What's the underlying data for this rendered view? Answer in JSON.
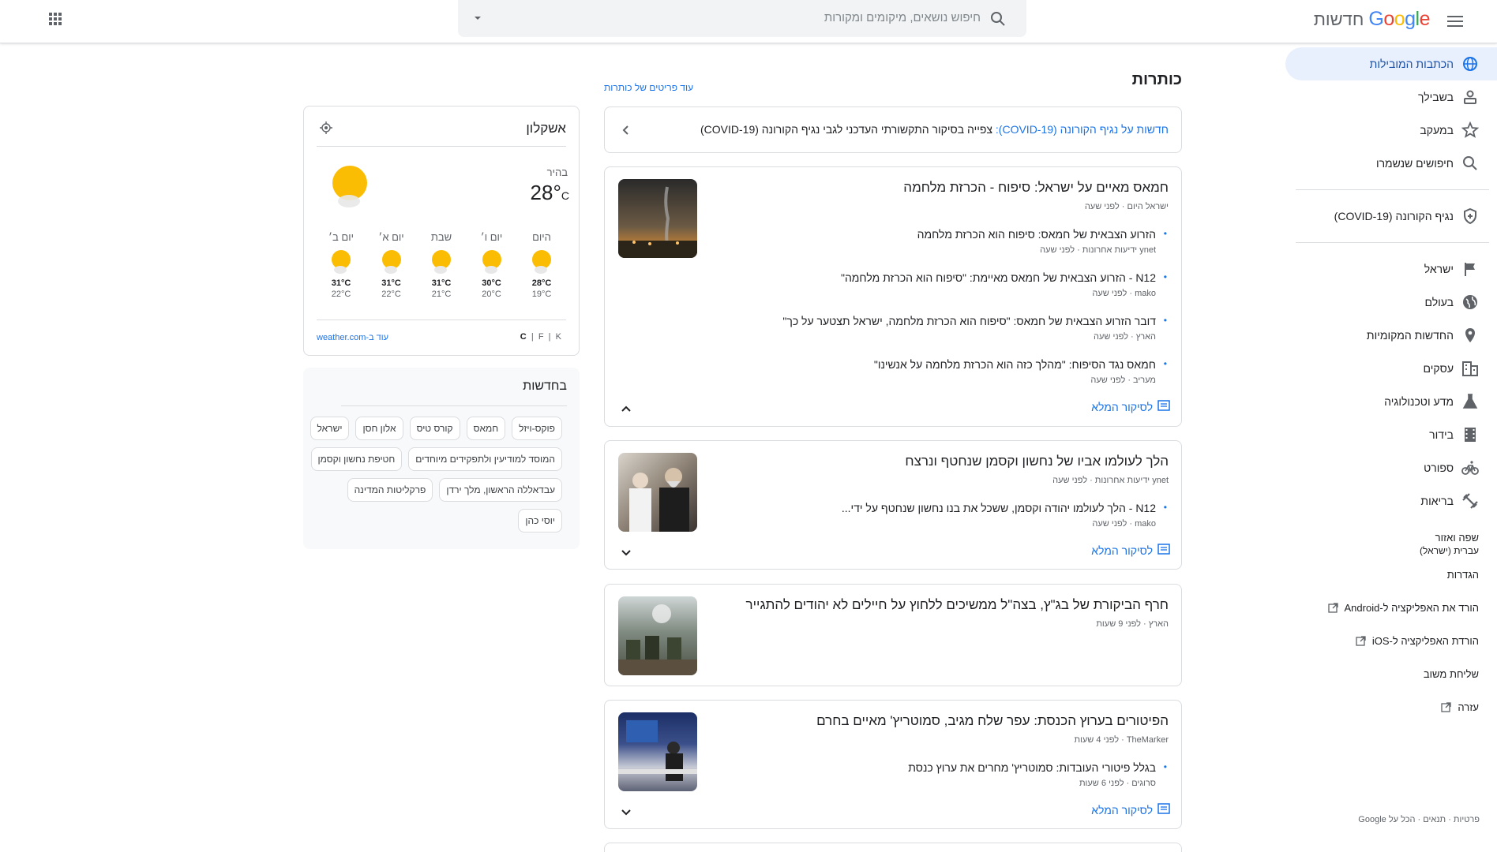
{
  "header": {
    "brand_google": "Google",
    "brand_news": "חדשות",
    "search_placeholder": "חיפוש נושאים, מיקומים ומקורות"
  },
  "sidebar": {
    "items": [
      {
        "label": "הכתבות המובילות",
        "icon": "globe-icon",
        "active": true
      },
      {
        "label": "בשבילך",
        "icon": "person-icon"
      },
      {
        "label": "במעקב",
        "icon": "star-icon"
      },
      {
        "label": "חיפושים שנשמרו",
        "icon": "search-icon"
      }
    ],
    "covid": {
      "label": "נגיף הקורונה (COVID-19)",
      "icon": "shield-icon"
    },
    "sections": [
      {
        "label": "ישראל",
        "icon": "flag-icon"
      },
      {
        "label": "בעולם",
        "icon": "world-icon"
      },
      {
        "label": "החדשות המקומיות",
        "icon": "pin-icon"
      },
      {
        "label": "עסקים",
        "icon": "building-icon"
      },
      {
        "label": "מדע וטכנולוגיה",
        "icon": "flask-icon"
      },
      {
        "label": "בידור",
        "icon": "film-icon"
      },
      {
        "label": "ספורט",
        "icon": "bicycle-icon"
      },
      {
        "label": "בריאות",
        "icon": "dumbbell-icon"
      }
    ],
    "language_title": "שפה ואזור",
    "language_value": "עברית (ישראל)",
    "settings": "הגדרות",
    "android": "הורד את האפליקציה ל-Android",
    "ios": "הורדת האפליקציה ל-iOS",
    "feedback": "שליחת משוב",
    "help": "עזרה",
    "footer": "פרטיות · תנאים · הכל על Google"
  },
  "main": {
    "title": "כותרות",
    "more_headlines": "עוד פריטים של כותרות",
    "covid_banner_link": "חדשות על נגיף הקורונה (COVID-19):",
    "covid_banner_text": "צפייה בסיקור התקשורתי העדכני לגבי נגיף הקורונה (COVID-19)",
    "full_coverage": "לסיקור המלא",
    "stories": [
      {
        "title": "חמאס מאיים על ישראל: סיפוח - הכרזת מלחמה",
        "meta": "ישראל היום · לפני שעה",
        "subs": [
          {
            "title": "הזרוע הצבאית של חמאס: סיפוח הוא הכרזת מלחמה",
            "meta": "ynet ידיעות אחרונות · לפני שעה"
          },
          {
            "title": "N12 - הזרוע הצבאית של חמאס מאיימת: \"סיפוח הוא הכרזת מלחמה\"",
            "meta": "mako · לפני שעה"
          },
          {
            "title": "דובר הזרוע הצבאית של חמאס: \"סיפוח הוא הכרזת מלחמה, ישראל תצטער על כך\"",
            "meta": "הארץ · לפני שעה"
          },
          {
            "title": "חמאס נגד הסיפוח: \"מהלך כזה הוא הכרזת מלחמה על אנשינו\"",
            "meta": "מעריב · לפני שעה"
          }
        ]
      },
      {
        "title": "הלך לעולמו אביו של נחשון וקסמן שנחטף ונרצח",
        "meta": "ynet ידיעות אחרונות · לפני שעה",
        "subs": [
          {
            "title": "N12 - הלך לעולמו יהודה וקסמן, ששכל את בנו נחשון שנחטף על ידי...",
            "meta": "mako · לפני שעה"
          }
        ]
      },
      {
        "title": "חרף הביקורת של בג\"ץ, בצה\"ל ממשיכים ללחוץ על חיילים לא יהודים להתגייר",
        "meta": "הארץ · לפני 9 שעות"
      },
      {
        "title": "הפיטורים בערוץ הכנסת: עפר שלח מגיב, סמוטריץ' מאיים בחרם",
        "meta": "TheMarker · לפני 4 שעות",
        "subs": [
          {
            "title": "בגלל פיטורי העובדות: סמוטריץ' מחרים את ערוץ כנסת",
            "meta": "סרוגים · לפני 6 שעות"
          }
        ]
      }
    ]
  },
  "weather": {
    "location": "אשקלון",
    "condition": "בהיר",
    "temp": "28°",
    "unit": "C",
    "days": [
      {
        "name": "היום",
        "hi": "28°C",
        "lo": "19°C"
      },
      {
        "name": "יום ו׳",
        "hi": "30°C",
        "lo": "20°C"
      },
      {
        "name": "שבת",
        "hi": "31°C",
        "lo": "21°C"
      },
      {
        "name": "יום א׳",
        "hi": "31°C",
        "lo": "22°C"
      },
      {
        "name": "יום ב׳",
        "hi": "31°C",
        "lo": "22°C"
      }
    ],
    "units": [
      "C",
      "F",
      "K"
    ],
    "source": "עוד ב-weather.com"
  },
  "in_the_news": {
    "title": "בחדשות",
    "chips": [
      "פוקס-ויזל",
      "חמאס",
      "קורס טיס",
      "אלון חסן",
      "ישראל",
      "המוסד למודיעין ולתפקידים מיוחדים",
      "חטיפת נחשון וקסמן",
      "עבדאללה הראשון, מלך ירדן",
      "פרקליטות המדינה",
      "יוסי כהן"
    ]
  },
  "colors": {
    "accent": "#1a73e8",
    "active_bg": "#e8f0fe",
    "sun": "#fbbc04"
  }
}
